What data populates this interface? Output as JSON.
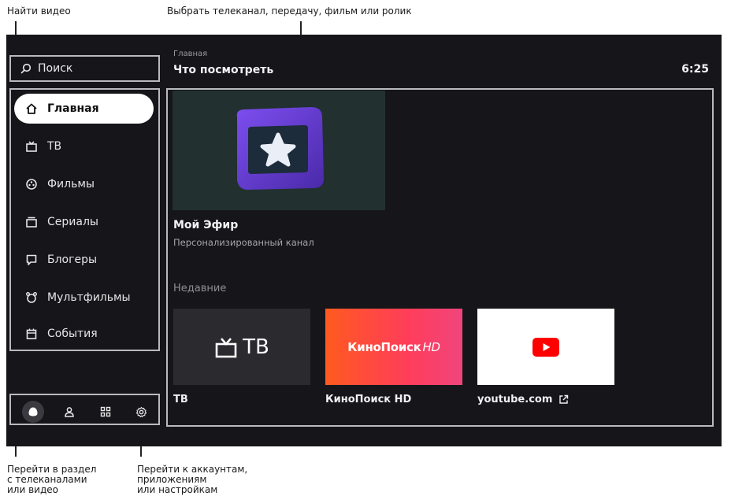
{
  "annotations": {
    "find_video": "Найти видео",
    "choose_content": "Выбрать телеканал, передачу, фильм или ролик",
    "section_lines": [
      "Перейти в раздел",
      "с телеканалами",
      "или видео"
    ],
    "account_lines": [
      "Перейти к аккаунтам,",
      "приложениям",
      "или настройкам"
    ]
  },
  "search": {
    "label": "Поиск",
    "icon": "search-icon"
  },
  "sidebar": {
    "items": [
      {
        "label": "Главная",
        "icon": "home-icon",
        "active": true
      },
      {
        "label": "ТВ",
        "icon": "tv-icon"
      },
      {
        "label": "Фильмы",
        "icon": "film-reel-icon"
      },
      {
        "label": "Сериалы",
        "icon": "series-icon"
      },
      {
        "label": "Блогеры",
        "icon": "bloggers-icon"
      },
      {
        "label": "Мультфильмы",
        "icon": "cartoon-icon"
      },
      {
        "label": "События",
        "icon": "calendar-icon"
      }
    ],
    "bottom_icons": [
      "alice-icon",
      "profile-icon",
      "apps-grid-icon",
      "settings-gear-icon"
    ]
  },
  "header": {
    "breadcrumb": "Главная",
    "title": "Что посмотреть",
    "clock": "6:25"
  },
  "featured": {
    "title": "Мой Эфир",
    "subtitle": "Персонализированный канал"
  },
  "recent": {
    "heading": "Недавние",
    "tiles": [
      {
        "label": "ТВ",
        "logo": "ТВ"
      },
      {
        "label": "КиноПоиск HD",
        "logo": "КиноПоиск",
        "logo_suffix": "HD"
      },
      {
        "label": "youtube.com",
        "icon": "external-link-icon"
      }
    ]
  },
  "colors": {
    "screen_bg": "#16161a",
    "featured_purple": "#6a3ed0",
    "kinopoisk_orange": "#ff5a1f",
    "youtube_red": "#ff0000"
  }
}
